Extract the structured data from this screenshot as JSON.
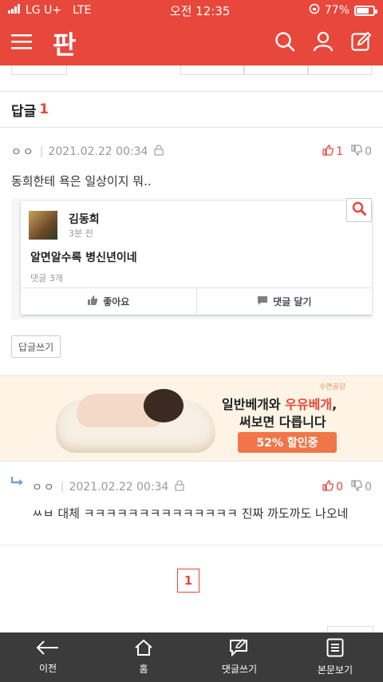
{
  "status_bar": {
    "carrier": "LG U+",
    "network": "LTE",
    "time": "오전 12:35",
    "battery": "77%",
    "battery_level": 0.77
  },
  "header": {
    "logo": "판",
    "icons": [
      "menu-icon",
      "search-icon",
      "user-icon",
      "write-icon"
    ],
    "color": "#e8473b"
  },
  "replies": {
    "title": "답글",
    "count": "1"
  },
  "comments": [
    {
      "author": "ㅇㅇ",
      "date": "2021.02.22 00:34",
      "likes": "1",
      "dislikes": "0",
      "text": "동희한테 욕은 일상이지 뭐..",
      "embedded_post": {
        "name": "김동희",
        "time": "3분 전",
        "body": "알면알수록 병신년이네",
        "comment_count": "댓글 3개",
        "like_label": "좋아요",
        "comment_label": "댓글 달기"
      },
      "reply_button": "답글쓰기"
    },
    {
      "author": "ㅇㅇ",
      "date": "2021.02.22 00:34",
      "likes": "0",
      "dislikes": "0",
      "text": "ㅆㅂ 대체 ㅋㅋㅋㅋㅋㅋㅋㅋㅋㅋㅋㅋㅋㅋ 진짜 까도까도 나오네"
    }
  ],
  "ad": {
    "line1_prefix": "일반베개와 ",
    "line1_accent": "우유베개",
    "line1_suffix": ",",
    "line2": "써보면 다릅니다",
    "cta": "52% 할인중",
    "brand": "수면공감"
  },
  "pagination": {
    "current": "1"
  },
  "bottom_nav": [
    {
      "label": "이전",
      "icon": "back-arrow-icon"
    },
    {
      "label": "홈",
      "icon": "home-icon"
    },
    {
      "label": "댓글쓰기",
      "icon": "comment-write-icon"
    },
    {
      "label": "본문보기",
      "icon": "document-icon"
    }
  ]
}
